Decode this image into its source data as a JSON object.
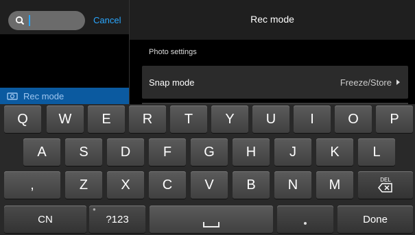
{
  "search": {
    "placeholder": "",
    "cancel_label": "Cancel"
  },
  "sidebar": {
    "items": [
      {
        "label": "Rec mode",
        "icon": "camera-icon"
      }
    ]
  },
  "header": {
    "title": "Rec mode"
  },
  "main": {
    "section_label": "Photo settings",
    "rows": [
      {
        "label": "Snap mode",
        "value": "Freeze/Store"
      }
    ]
  },
  "keyboard": {
    "row1": [
      "Q",
      "W",
      "E",
      "R",
      "T",
      "Y",
      "U",
      "I",
      "O",
      "P"
    ],
    "row2": [
      "A",
      "S",
      "D",
      "F",
      "G",
      "H",
      "J",
      "K",
      "L"
    ],
    "row3": [
      ",",
      "Z",
      "X",
      "C",
      "V",
      "B",
      "N",
      "M"
    ],
    "del_label": "DEL",
    "cn_label": "CN",
    "sym_label": "?123",
    "done_label": "Done"
  },
  "colors": {
    "accent": "#2aa7ff",
    "selected": "#0b5aa0",
    "key": "#4a4a4a"
  }
}
